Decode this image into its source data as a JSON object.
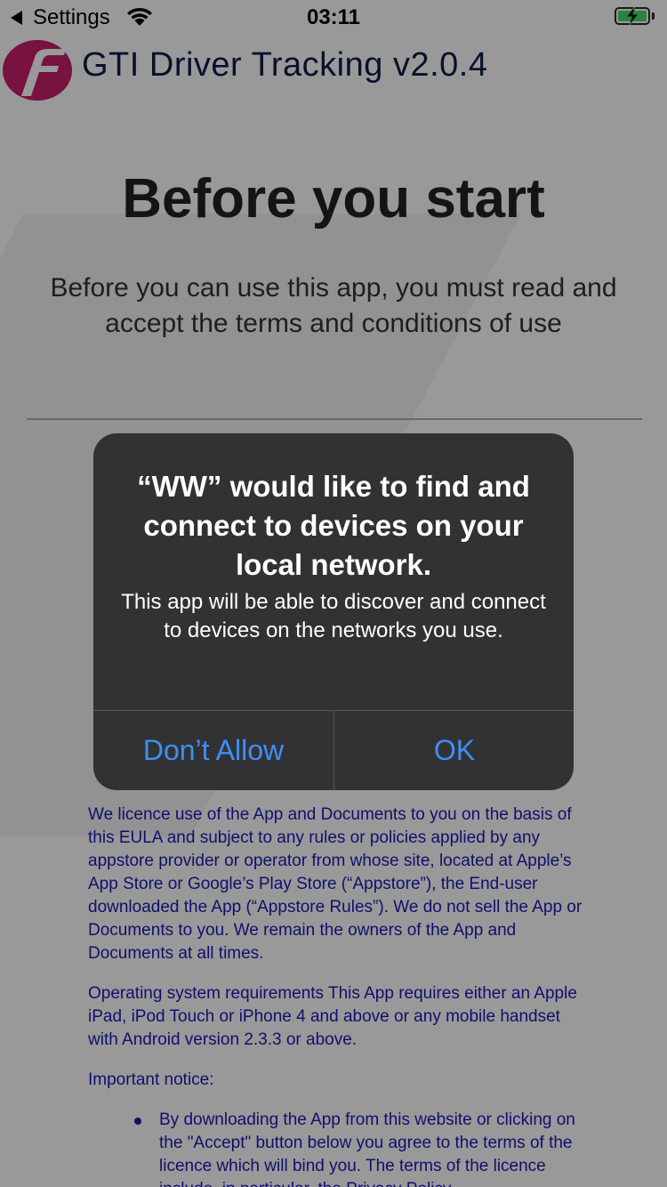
{
  "status_bar": {
    "back_label": "Settings",
    "time": "03:11",
    "battery_color": "#4cd964"
  },
  "header": {
    "app_title": "GTI Driver Tracking v2.0.4",
    "logo_color": "#c81e6a",
    "title_color": "#0c1d4a"
  },
  "page": {
    "title": "Before you start",
    "intro": "Before you can use this app, you must read and accept the terms and conditions of use"
  },
  "eula": {
    "link_color": "#1a1ab8",
    "paragraphs": [
      "We licence use of the App and Documents to you on the basis of this EULA and subject to any rules or policies applied by any appstore provider or operator from whose site, located at Apple’s App Store or Google’s Play Store (“Appstore”), the End-user downloaded the App (“Appstore Rules”). We do not sell the App or Documents to you. We remain the owners of the App and Documents at all times.",
      "Operating system requirements This App requires either an Apple iPad, iPod Touch or iPhone 4 and above or any mobile handset with Android version 2.3.3 or above.",
      "Important notice:"
    ],
    "bullet": "By downloading the App from this website or clicking on the \"Accept\" button below you agree to the terms of the licence which will bind you. The terms of the licence include, in particular, the Privacy Policy"
  },
  "alert": {
    "title": "“WW” would like to find and connect to devices on your local network.",
    "message": "This app will be able to discover and connect to devices on the networks you use.",
    "deny_label": "Don’t Allow",
    "ok_label": "OK",
    "button_color": "#3e8ff5"
  }
}
